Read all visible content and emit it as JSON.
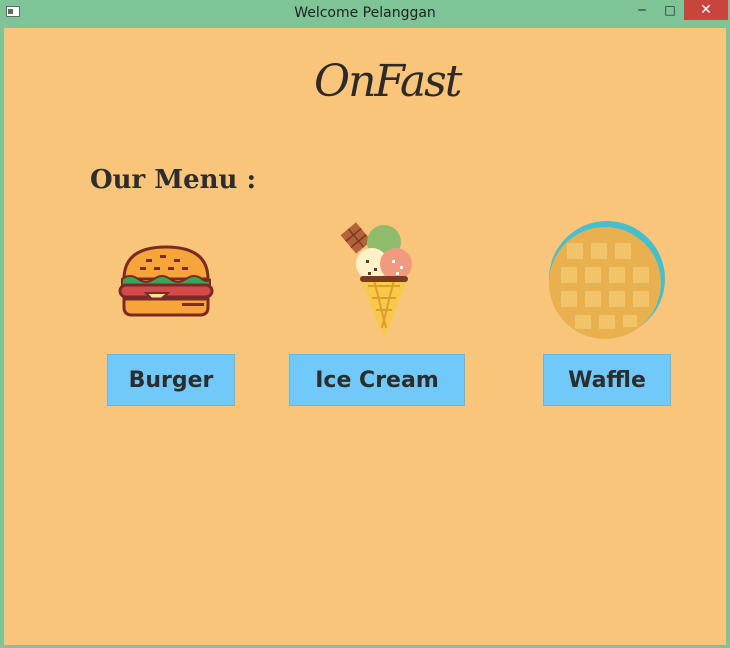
{
  "window": {
    "title": "Welcome Pelanggan",
    "minimize_glyph": "─",
    "maximize_glyph": "□",
    "close_glyph": "✕"
  },
  "header": {
    "logo": "OnFast"
  },
  "menu": {
    "title": "Our Menu :",
    "items": [
      {
        "label": "Burger",
        "icon": "burger-icon"
      },
      {
        "label": "Ice Cream",
        "icon": "ice-cream-icon"
      },
      {
        "label": "Waffle",
        "icon": "waffle-icon"
      }
    ]
  },
  "colors": {
    "titlebar": "#7fc497",
    "background": "#f9c57a",
    "button": "#70c9f8",
    "close": "#c7453d",
    "text": "#2d2d2d"
  }
}
